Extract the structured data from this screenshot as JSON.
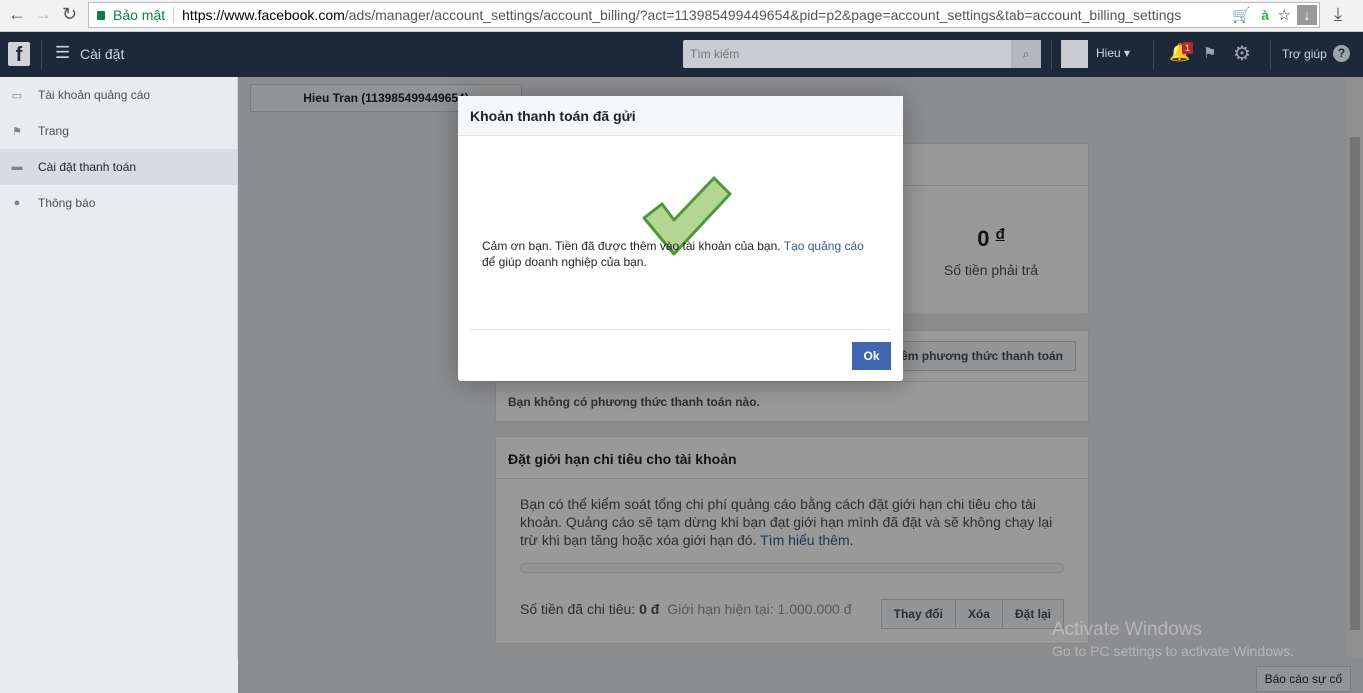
{
  "browser": {
    "secure_label": "Bảo mật",
    "url_host": "https://www.facebook.com",
    "url_path": "/ads/manager/account_settings/account_billing/?act=113985499449654&pid=p2&page=account_settings&tab=account_billing_settings"
  },
  "header": {
    "title": "Cài đặt",
    "search_placeholder": "Tìm kiếm",
    "user": "Hieu",
    "notifications": "1",
    "help": "Trợ giúp"
  },
  "sidebar": {
    "items": [
      {
        "label": "Tài khoản quảng cáo",
        "icon": "ad-account-icon"
      },
      {
        "label": "Trang",
        "icon": "flag-icon"
      },
      {
        "label": "Cài đặt thanh toán",
        "icon": "credit-card-icon",
        "active": true
      },
      {
        "label": "Thông báo",
        "icon": "globe-icon"
      }
    ]
  },
  "main": {
    "account_selector": "Hieu Tran (113985499449654)",
    "summary": {
      "amount": "0",
      "currency": "đ",
      "amount_label": "Số tiền phải trả"
    },
    "payment": {
      "add_button": "Thêm phương thức thanh toán",
      "empty": "Bạn không có phương thức thanh toán nào."
    },
    "limit": {
      "title": "Đặt giới hạn chi tiêu cho tài khoản",
      "text": "Bạn có thể kiểm soát tổng chi phí quảng cáo bằng cách đặt giới hạn chi tiêu cho tài khoản. Quảng cáo sẽ tạm dừng khi bạn đạt giới hạn mình đã đặt và sẽ không chạy lại trừ khi bạn tăng hoặc xóa giới hạn đó.",
      "learn_more": "Tìm hiểu thêm.",
      "spent_label": "Số tiền đã chi tiêu:",
      "spent_value": "0 đ",
      "limit_label": "Giới hạn hiện tại: 1.000.000 đ",
      "progress_percent": 0,
      "buttons": [
        "Thay đổi",
        "Xóa",
        "Đặt lại"
      ]
    }
  },
  "dialog": {
    "title": "Khoản thanh toán đã gửi",
    "message": "Cảm ơn bạn. Tiền đã được thêm vào tài khoản của bạn.",
    "link": "Tạo quảng cáo",
    "message_end": "để giúp doanh nghiệp của bạn.",
    "ok": "Ok"
  },
  "footer": {
    "report": "Báo cáo sự cố"
  },
  "watermark": {
    "line1": "Activate Windows",
    "line2": "Go to PC settings to activate Windows."
  },
  "colors": {
    "fb_header": "#1d2939",
    "primary": "#4267b2",
    "link": "#365899",
    "check_green": "#b5d692"
  }
}
